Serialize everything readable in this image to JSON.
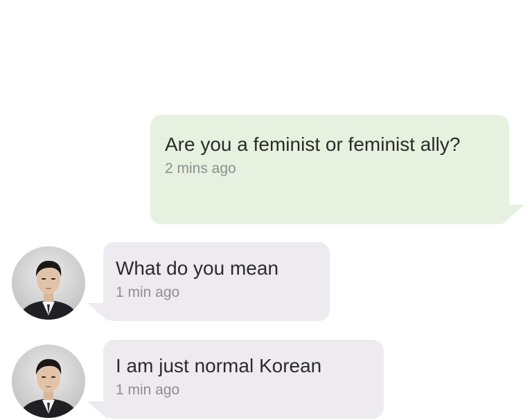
{
  "messages": [
    {
      "direction": "outgoing",
      "text": "Are you a feminist or feminist ally?",
      "time": "2 mins ago"
    },
    {
      "direction": "incoming",
      "text": "What do you mean",
      "time": "1 min ago"
    },
    {
      "direction": "incoming",
      "text": "I am just normal Korean",
      "time": "1 min ago"
    }
  ],
  "colors": {
    "outgoing_bubble": "#e6f1df",
    "incoming_bubble": "#eeebf0",
    "text": "#2b2b2b",
    "timestamp": "#8e8e8e"
  },
  "avatar": {
    "icon": "person-avatar-icon"
  }
}
